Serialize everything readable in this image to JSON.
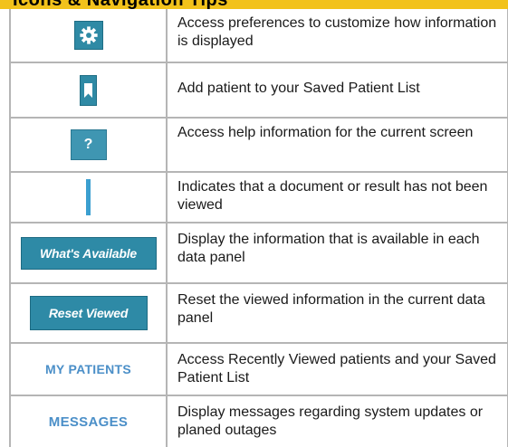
{
  "header": {
    "title": "Icons & Navigation Tips"
  },
  "rows": [
    {
      "icon": "gear-icon",
      "description": "Access preferences to customize how information is displayed"
    },
    {
      "icon": "bookmark-icon",
      "description": "Add patient to your Saved Patient List"
    },
    {
      "icon": "help-icon",
      "icon_label": "?",
      "description": "Access help information for the current screen"
    },
    {
      "icon": "unviewed-bar-icon",
      "description": "Indicates that a document or result has not been viewed"
    },
    {
      "button_label": "What's Available",
      "description": "Display the information that is available in each data panel"
    },
    {
      "button_label": "Reset Viewed",
      "description": "Reset the viewed information in the current data panel"
    },
    {
      "link_label": "MY PATIENTS",
      "description": "Access Recently Viewed patients and your Saved Patient List"
    },
    {
      "link_label": "MESSAGES",
      "description": "Display messages regarding system updates or planed outages"
    }
  ],
  "colors": {
    "accent": "#2f8aa5",
    "header_band": "#f2c21b",
    "link": "#4b8fc8",
    "unviewed_bar": "#3b9fd0"
  }
}
